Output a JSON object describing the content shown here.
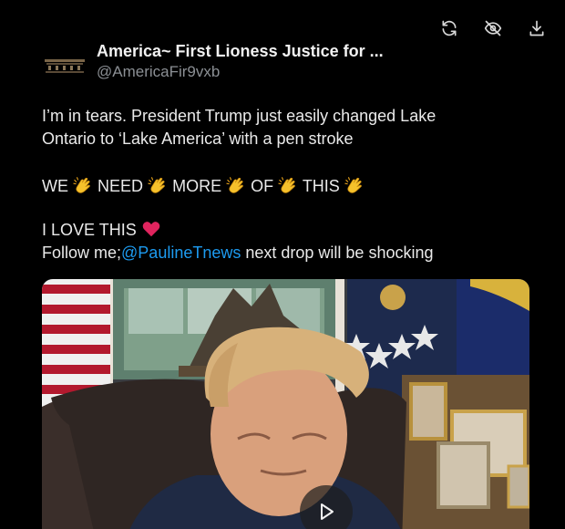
{
  "toolbar": {
    "refresh_icon": "refresh-icon",
    "hide_icon": "eye-off-icon",
    "download_icon": "download-icon"
  },
  "author": {
    "display_name": "America~ First Lioness Justice for ...",
    "handle": "@AmericaFir9vxb"
  },
  "tweet": {
    "line1": "I’m in tears. President Trump just easily changed Lake",
    "line2": "Ontario to ‘Lake America’ with a pen stroke",
    "we": "WE",
    "need": "NEED",
    "more": "MORE",
    "of": "OF",
    "this": "THIS",
    "love": "I LOVE THIS",
    "follow_prefix": "Follow me;",
    "mention": "@PaulineTnews",
    "follow_suffix": " next drop will be shocking"
  },
  "media": {
    "type": "video",
    "play_icon": "play-icon"
  },
  "colors": {
    "background": "#000000",
    "mention": "#1d9bf0",
    "heart": "#e0245e",
    "clap": "#f6c12b"
  }
}
